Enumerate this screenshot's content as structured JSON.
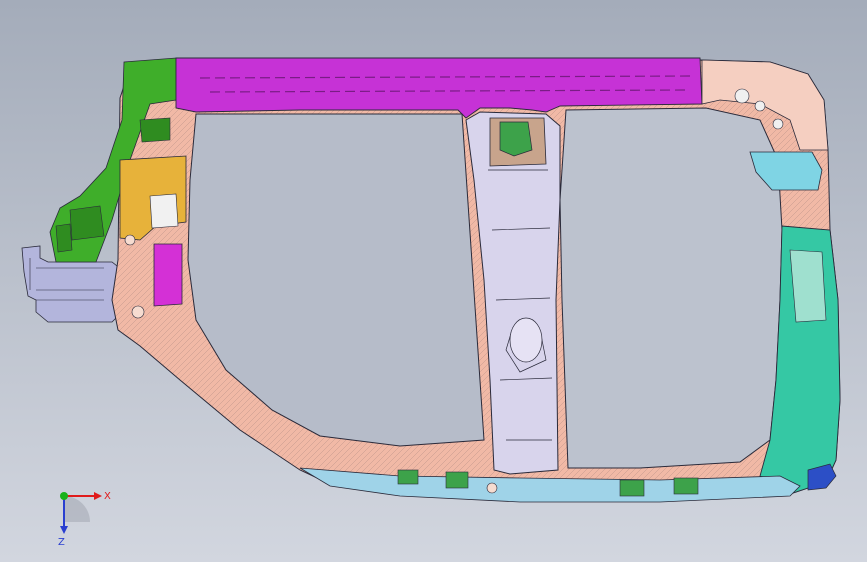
{
  "viewport": {
    "background_top": "#a4acba",
    "background_bottom": "#d2d6df"
  },
  "parts": {
    "roof_rail": "#c632d6",
    "a_pillar_upper": "#3fae2a",
    "a_pillar_bracket": "#e7b23a",
    "hinge_reinforcement": "#d430d6",
    "outer_panel": "#f1b9a6",
    "outer_panel_light": "#f5cfc1",
    "b_pillar_inner": "#d8d4ec",
    "b_pillar_top_bracket": "#c8a48c",
    "b_pillar_clip": "#3da24a",
    "rocker_sill": "#9fd3e8",
    "c_pillar_panel": "#35c8a4",
    "c_pillar_bracket": "#7fd4e4",
    "c_pillar_light": "#9fe0cf",
    "wheel_arch_cap": "#2c4fc6",
    "a_pillar_lower_extension": "#b3b5dc",
    "outline": "#2a2a3a"
  },
  "triad": {
    "x_label": "X",
    "z_label": "Z",
    "x_color": "#e01b1b",
    "y_color": "#19b219",
    "z_color": "#2a3fd0"
  }
}
